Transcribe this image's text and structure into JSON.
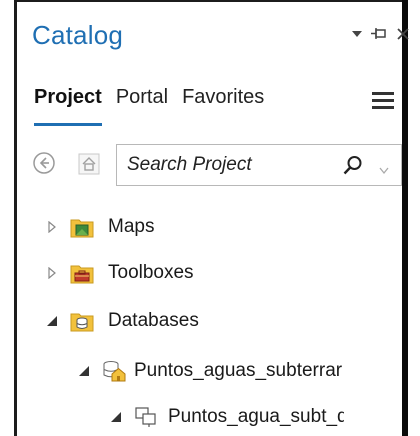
{
  "panel": {
    "title": "Catalog",
    "controls": [
      "menu-down",
      "pin",
      "close"
    ]
  },
  "tabs": [
    {
      "label": "Project",
      "active": true
    },
    {
      "label": "Portal",
      "active": false
    },
    {
      "label": "Favorites",
      "active": false
    }
  ],
  "search": {
    "placeholder": "Search Project"
  },
  "tree": [
    {
      "label": "Maps",
      "expanded": false,
      "icon": "maps-folder-icon"
    },
    {
      "label": "Toolboxes",
      "expanded": false,
      "icon": "toolboxes-folder-icon"
    },
    {
      "label": "Databases",
      "expanded": true,
      "icon": "databases-folder-icon"
    },
    {
      "label": "Puntos_aguas_subterrar",
      "expanded": true,
      "icon": "geodatabase-home-icon"
    },
    {
      "label": "Puntos_agua_subt_de",
      "expanded": true,
      "icon": "feature-dataset-icon"
    }
  ],
  "colors": {
    "accent": "#1f6fb3",
    "folder": "#f2c13c"
  }
}
